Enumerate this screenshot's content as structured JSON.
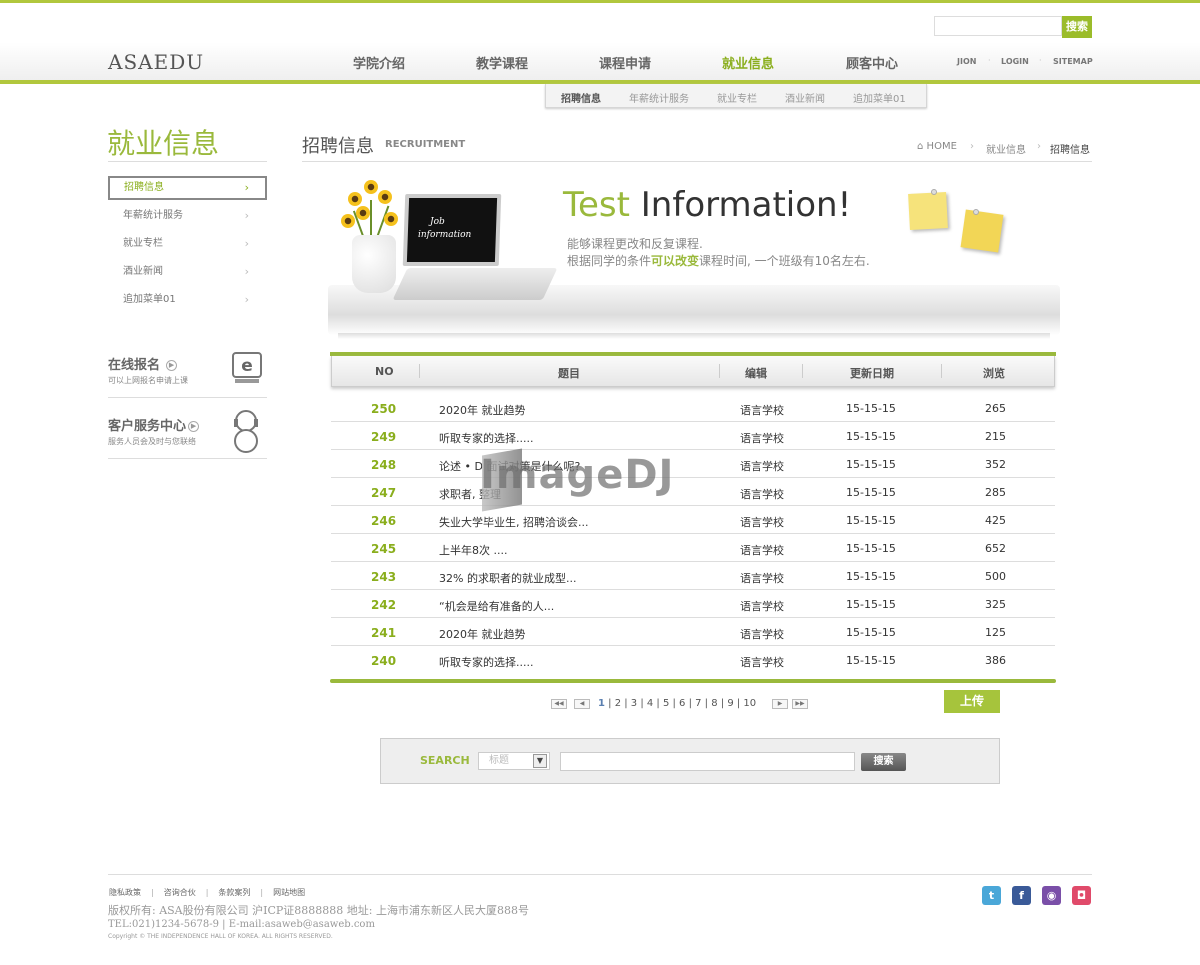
{
  "header": {
    "logo": "ASAEDU",
    "search_button": "搜索",
    "nav": [
      "学院介绍",
      "教学课程",
      "课程申请",
      "就业信息",
      "顾客中心"
    ],
    "active_nav": "就业信息",
    "util_links": [
      "JION",
      "LOGIN",
      "SITEMAP"
    ],
    "subnav": [
      "招聘信息",
      "年薪统计服务",
      "就业专栏",
      "酒业新闻",
      "追加菜单01"
    ]
  },
  "sidebar": {
    "title": "就业信息",
    "items": [
      "招聘信息",
      "年薪统计服务",
      "就业专栏",
      "酒业新闻",
      "追加菜单01"
    ],
    "box1": {
      "title": "在线报名",
      "sub": "可以上网报名申请上课"
    },
    "box2": {
      "title": "客户服务中心",
      "sub": "服务人员会及时与您联络"
    }
  },
  "page": {
    "title": "招聘信息",
    "title_en": "RECRUITMENT",
    "breadcrumb": [
      "HOME",
      "就业信息",
      "招聘信息"
    ]
  },
  "banner": {
    "title_green": "Test",
    "title_dark": "Information!",
    "line1": "能够课程更改和反复课程.",
    "line2_pre": "根据同学的条件",
    "line2_hl": "可以改变",
    "line2_post": "课程时间, 一个班级有10名左右.",
    "laptop_line1": "Job",
    "laptop_line2": "information"
  },
  "table": {
    "headers": [
      "NO",
      "题目",
      "编辑",
      "更新日期",
      "浏览"
    ],
    "rows": [
      {
        "no": "250",
        "title": "2020年  就业趋势",
        "editor": "语言学校",
        "date": "15-15-15",
        "views": "265"
      },
      {
        "no": "249",
        "title": "听取专家的选择.....",
        "editor": "语言学校",
        "date": "15-15-15",
        "views": "215"
      },
      {
        "no": "248",
        "title": "论述 • D      面试对策是什么呢?",
        "editor": "语言学校",
        "date": "15-15-15",
        "views": "352"
      },
      {
        "no": "247",
        "title": "求职者,      整理",
        "editor": "语言学校",
        "date": "15-15-15",
        "views": "285"
      },
      {
        "no": "246",
        "title": "失业大学毕业生, 招聘洽谈会...",
        "editor": "语言学校",
        "date": "15-15-15",
        "views": "425"
      },
      {
        "no": "245",
        "title": "上半年8次  ....",
        "editor": "语言学校",
        "date": "15-15-15",
        "views": "652"
      },
      {
        "no": "243",
        "title": "32% 的求职者的就业成型...",
        "editor": "语言学校",
        "date": "15-15-15",
        "views": "500"
      },
      {
        "no": "242",
        "title": "“机会是给有准备的人...",
        "editor": "语言学校",
        "date": "15-15-15",
        "views": "325"
      },
      {
        "no": "241",
        "title": "2020年  就业趋势",
        "editor": "语言学校",
        "date": "15-15-15",
        "views": "125"
      },
      {
        "no": "240",
        "title": "听取专家的选择.....",
        "editor": "语言学校",
        "date": "15-15-15",
        "views": "386"
      }
    ]
  },
  "pager": {
    "pages": "1 | 2 | 3 | 4 | 5 | 6 | 7 | 8 | 9 | 10",
    "current": "1",
    "rest": " | 2 | 3 | 4 | 5 | 6 | 7 | 8 | 9 | 10"
  },
  "upload_button": "上传",
  "search": {
    "label": "SEARCH",
    "select_value": "标题",
    "button": "搜索"
  },
  "footer": {
    "links": [
      "隐私政策",
      "咨询合伙",
      "条款案列",
      "网站地图"
    ],
    "copy1": "版权所有: ASA股份有限公司 沪ICP证8888888 地址: 上海市浦东新区人民大厦888号",
    "copy2": "TEL:021)1234-5678-9  |  E-mail:asaweb@asaweb.com",
    "copy3": "Copyright © THE INDEPENDENCE HALL OF KOREA. ALL RIGHTS RESERVED."
  },
  "watermark": "ImageDJ",
  "colors": {
    "accent": "#9ab93c",
    "accent_dark": "#8aae1d"
  }
}
